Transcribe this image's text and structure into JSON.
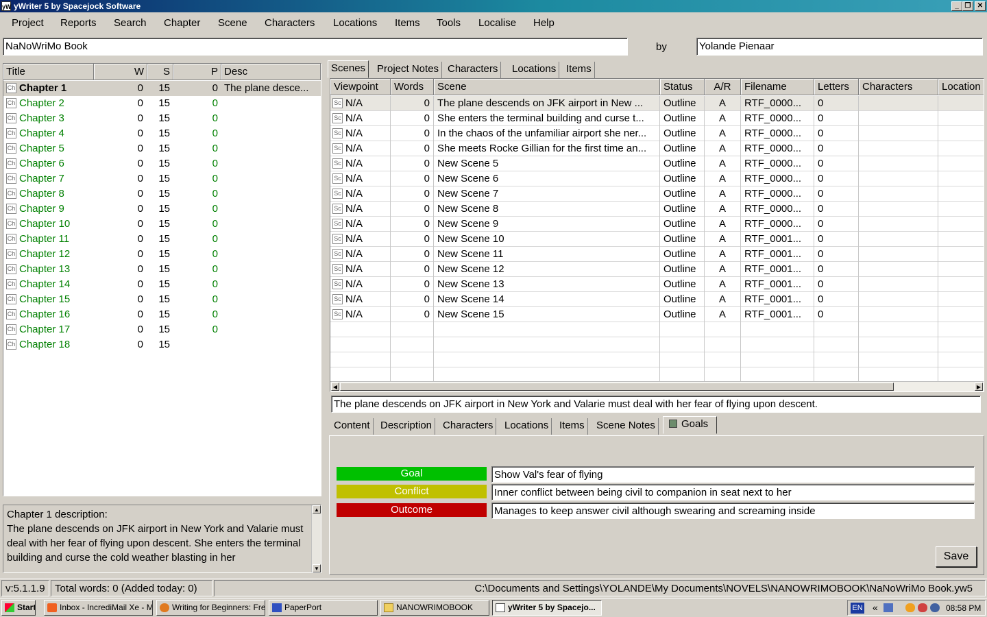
{
  "window": {
    "title": "yWriter 5 by Spacejock Software",
    "app_icon": "yW"
  },
  "menu": [
    "Project",
    "Reports",
    "Search",
    "Chapter",
    "Scene",
    "Characters",
    "Locations",
    "Items",
    "Tools",
    "Localise",
    "Help"
  ],
  "project": {
    "title": "NaNoWriMo Book",
    "by_label": "by",
    "author": "Yolande Pienaar"
  },
  "chapters": {
    "columns": [
      "Title",
      "W",
      "S",
      "P",
      "Desc"
    ],
    "rows": [
      {
        "title": "Chapter 1",
        "w": "0",
        "s": "15",
        "p": "0",
        "desc": "The plane desce..."
      },
      {
        "title": "Chapter 2",
        "w": "0",
        "s": "15",
        "p": "0",
        "desc": ""
      },
      {
        "title": "Chapter 3",
        "w": "0",
        "s": "15",
        "p": "0",
        "desc": ""
      },
      {
        "title": "Chapter 4",
        "w": "0",
        "s": "15",
        "p": "0",
        "desc": ""
      },
      {
        "title": "Chapter 5",
        "w": "0",
        "s": "15",
        "p": "0",
        "desc": ""
      },
      {
        "title": "Chapter 6",
        "w": "0",
        "s": "15",
        "p": "0",
        "desc": ""
      },
      {
        "title": "Chapter 7",
        "w": "0",
        "s": "15",
        "p": "0",
        "desc": ""
      },
      {
        "title": "Chapter 8",
        "w": "0",
        "s": "15",
        "p": "0",
        "desc": ""
      },
      {
        "title": "Chapter 9",
        "w": "0",
        "s": "15",
        "p": "0",
        "desc": ""
      },
      {
        "title": "Chapter 10",
        "w": "0",
        "s": "15",
        "p": "0",
        "desc": ""
      },
      {
        "title": "Chapter 11",
        "w": "0",
        "s": "15",
        "p": "0",
        "desc": ""
      },
      {
        "title": "Chapter 12",
        "w": "0",
        "s": "15",
        "p": "0",
        "desc": ""
      },
      {
        "title": "Chapter 13",
        "w": "0",
        "s": "15",
        "p": "0",
        "desc": ""
      },
      {
        "title": "Chapter 14",
        "w": "0",
        "s": "15",
        "p": "0",
        "desc": ""
      },
      {
        "title": "Chapter 15",
        "w": "0",
        "s": "15",
        "p": "0",
        "desc": ""
      },
      {
        "title": "Chapter 16",
        "w": "0",
        "s": "15",
        "p": "0",
        "desc": ""
      },
      {
        "title": "Chapter 17",
        "w": "0",
        "s": "15",
        "p": "0",
        "desc": ""
      },
      {
        "title": "Chapter 18",
        "w": "0",
        "s": "15",
        "p": "",
        "desc": ""
      }
    ],
    "icon_text": "Ch",
    "description_heading": "Chapter 1 description:",
    "description_text": "The plane descends on JFK airport in New York and Valarie must deal with her fear of flying upon descent. She enters the terminal building and curse the cold weather blasting in her"
  },
  "right_tabs": [
    "Scenes",
    "Project Notes",
    "Characters",
    "Locations",
    "Items"
  ],
  "scenes": {
    "columns": [
      "Viewpoint",
      "Words",
      "Scene",
      "Status",
      "A/R",
      "Filename",
      "Letters",
      "Characters",
      "Location"
    ],
    "icon_text": "Sc",
    "rows": [
      {
        "viewpoint": "N/A",
        "words": "0",
        "scene": "The plane descends on JFK airport in New ...",
        "status": "Outline",
        "ar": "A",
        "filename": "RTF_0000...",
        "letters": "0"
      },
      {
        "viewpoint": "N/A",
        "words": "0",
        "scene": "She enters the terminal building and curse t...",
        "status": "Outline",
        "ar": "A",
        "filename": "RTF_0000...",
        "letters": "0"
      },
      {
        "viewpoint": "N/A",
        "words": "0",
        "scene": "In the chaos of the unfamiliar airport she ner...",
        "status": "Outline",
        "ar": "A",
        "filename": "RTF_0000...",
        "letters": "0"
      },
      {
        "viewpoint": "N/A",
        "words": "0",
        "scene": "She meets Rocke Gillian for the first time an...",
        "status": "Outline",
        "ar": "A",
        "filename": "RTF_0000...",
        "letters": "0"
      },
      {
        "viewpoint": "N/A",
        "words": "0",
        "scene": "New Scene 5",
        "status": "Outline",
        "ar": "A",
        "filename": "RTF_0000...",
        "letters": "0"
      },
      {
        "viewpoint": "N/A",
        "words": "0",
        "scene": "New Scene 6",
        "status": "Outline",
        "ar": "A",
        "filename": "RTF_0000...",
        "letters": "0"
      },
      {
        "viewpoint": "N/A",
        "words": "0",
        "scene": "New Scene 7",
        "status": "Outline",
        "ar": "A",
        "filename": "RTF_0000...",
        "letters": "0"
      },
      {
        "viewpoint": "N/A",
        "words": "0",
        "scene": "New Scene 8",
        "status": "Outline",
        "ar": "A",
        "filename": "RTF_0000...",
        "letters": "0"
      },
      {
        "viewpoint": "N/A",
        "words": "0",
        "scene": "New Scene 9",
        "status": "Outline",
        "ar": "A",
        "filename": "RTF_0000...",
        "letters": "0"
      },
      {
        "viewpoint": "N/A",
        "words": "0",
        "scene": "New Scene 10",
        "status": "Outline",
        "ar": "A",
        "filename": "RTF_0001...",
        "letters": "0"
      },
      {
        "viewpoint": "N/A",
        "words": "0",
        "scene": "New Scene 11",
        "status": "Outline",
        "ar": "A",
        "filename": "RTF_0001...",
        "letters": "0"
      },
      {
        "viewpoint": "N/A",
        "words": "0",
        "scene": "New Scene 12",
        "status": "Outline",
        "ar": "A",
        "filename": "RTF_0001...",
        "letters": "0"
      },
      {
        "viewpoint": "N/A",
        "words": "0",
        "scene": "New Scene 13",
        "status": "Outline",
        "ar": "A",
        "filename": "RTF_0001...",
        "letters": "0"
      },
      {
        "viewpoint": "N/A",
        "words": "0",
        "scene": "New Scene 14",
        "status": "Outline",
        "ar": "A",
        "filename": "RTF_0001...",
        "letters": "0"
      },
      {
        "viewpoint": "N/A",
        "words": "0",
        "scene": "New Scene 15",
        "status": "Outline",
        "ar": "A",
        "filename": "RTF_0001...",
        "letters": "0"
      }
    ],
    "selected_description": "The plane descends on JFK airport in New York and Valarie must deal with her fear of flying upon descent."
  },
  "scene_tabs": [
    "Content",
    "Description",
    "Characters",
    "Locations",
    "Items",
    "Scene Notes",
    "Goals"
  ],
  "goals": {
    "goal_label": "Goal",
    "goal_text": "Show Val's fear of flying",
    "goal_color": "#00c000",
    "conflict_label": "Conflict",
    "conflict_text": "Inner conflict between being civil to companion in seat next to her",
    "conflict_color": "#c0c000",
    "outcome_label": "Outcome",
    "outcome_text": "Manages to keep answer civil although swearing and screaming inside",
    "outcome_color": "#c00000",
    "save_label": "Save"
  },
  "status": {
    "version": "v:5.1.1.9",
    "words": "Total words: 0 (Added today: 0)",
    "path": "C:\\Documents and Settings\\YOLANDE\\My Documents\\NOVELS\\NANOWRIMOBOOK\\NaNoWriMo Book.yw5"
  },
  "taskbar": {
    "start": "Start",
    "items": [
      "Inbox - IncrediMail Xe - M...",
      "Writing for Beginners: Fre...",
      "PaperPort",
      "NANOWRIMOBOOK",
      "yWriter 5 by Spacejo..."
    ],
    "lang": "EN",
    "tray_chevron": "«",
    "time": "08:58 PM"
  }
}
